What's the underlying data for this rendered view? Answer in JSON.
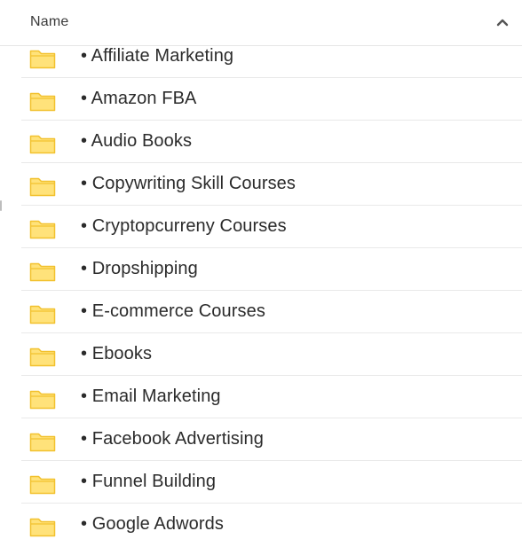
{
  "header": {
    "column_label": "Name",
    "sort_icon": "chevron-up-icon"
  },
  "folder_icon": "folder-icon",
  "colors": {
    "folder_fill": "#FFE27A",
    "folder_stroke": "#F2C12E",
    "divider": "#E9E9E9",
    "text": "#2B2B2B"
  },
  "items": [
    {
      "label": "• Affiliate Marketing"
    },
    {
      "label": "• Amazon FBA"
    },
    {
      "label": "• Audio Books"
    },
    {
      "label": "• Copywriting Skill Courses"
    },
    {
      "label": "• Cryptopcurreny Courses"
    },
    {
      "label": "• Dropshipping"
    },
    {
      "label": "• E-commerce Courses"
    },
    {
      "label": "• Ebooks"
    },
    {
      "label": "• Email Marketing"
    },
    {
      "label": "• Facebook Advertising"
    },
    {
      "label": "• Funnel Building"
    },
    {
      "label": "• Google Adwords"
    }
  ]
}
